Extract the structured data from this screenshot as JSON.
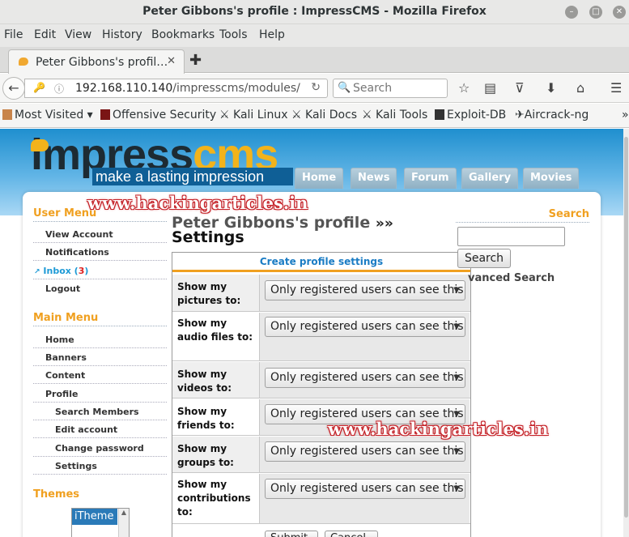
{
  "window": {
    "title": "Peter Gibbons's profile : ImpressCMS - Mozilla Firefox"
  },
  "menubar": [
    "File",
    "Edit",
    "View",
    "History",
    "Bookmarks",
    "Tools",
    "Help"
  ],
  "tab": {
    "label": "Peter Gibbons's profil…"
  },
  "address": {
    "url_prefix": "192.168.110.140",
    "url_path": "/impresscms/modules/"
  },
  "search": {
    "placeholder": "Search"
  },
  "bookmarks": [
    "Most Visited",
    "Offensive Security",
    "Kali Linux",
    "Kali Docs",
    "Kali Tools",
    "Exploit-DB",
    "Aircrack-ng"
  ],
  "site": {
    "logo_a": "impress",
    "logo_b": "cms",
    "tagline": "make a lasting impression",
    "nav": [
      "Home",
      "News",
      "Forum",
      "Gallery",
      "Movies"
    ]
  },
  "watermark": "www.hackingarticles.in",
  "user_menu": {
    "title": "User Menu",
    "items": [
      "View Account",
      "Notifications",
      "Inbox",
      "Logout"
    ],
    "inbox_label": "Inbox (",
    "inbox_count": "3",
    "inbox_close": ")"
  },
  "main_menu": {
    "title": "Main Menu",
    "items": [
      "Home",
      "Banners",
      "Content",
      "Profile"
    ],
    "sub_items": [
      "Search Members",
      "Edit account",
      "Change password",
      "Settings"
    ]
  },
  "themes": {
    "title": "Themes",
    "selected": "iTheme"
  },
  "heading": {
    "profile": "Peter Gibbons's profile",
    "separator": "»»",
    "section": "Settings"
  },
  "form": {
    "title": "Create profile settings",
    "rows": [
      {
        "label": "Show my pictures to:",
        "value": "Only registered users can see this"
      },
      {
        "label": "Show my audio files to:",
        "value": "Only registered users can see this"
      },
      {
        "label": "Show my videos to:",
        "value": "Only registered users can see this"
      },
      {
        "label": "Show my friends to:",
        "value": "Only registered users can see this"
      },
      {
        "label": "Show my groups to:",
        "value": "Only registered users can see this"
      },
      {
        "label": "Show my contributions to:",
        "value": "Only registered users can see this"
      }
    ],
    "submit_label": "Submit",
    "cancel_label": "Cancel"
  },
  "right_search": {
    "title": "Search",
    "button": "Search",
    "advanced": "vanced Search"
  }
}
